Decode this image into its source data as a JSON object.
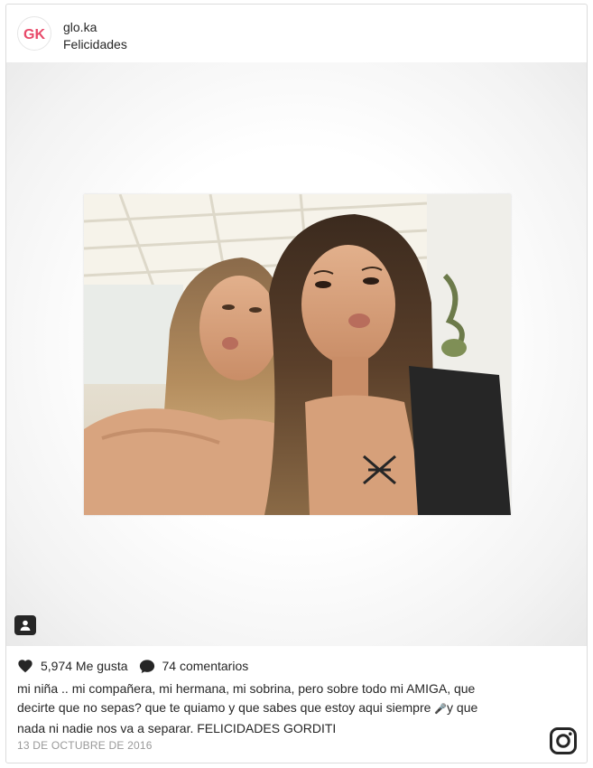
{
  "post": {
    "username": "glo.ka",
    "location": "Felicidades",
    "avatar_initials": "GK",
    "likes": "5,974 Me gusta",
    "comments": "74 comentarios",
    "caption_line1": "mi niña .. mi compañera, mi hermana, mi sobrina, pero sobre todo mi AMIGA, que",
    "caption_line2": "decirte que no sepas? que te quiamo y que sabes que estoy aqui siempre ",
    "caption_emoji": "🎤",
    "caption_line2_end": "y que",
    "caption_line3": "nada ni nadie nos va a separar. FELICIDADES GORDITI",
    "date": "13 DE OCTUBRE DE 2016"
  },
  "icons": {
    "like": "heart-icon",
    "comment": "comment-bubble-icon",
    "user_tag": "user-tag-icon",
    "brand": "instagram-logo-icon"
  },
  "colors": {
    "text": "#262626",
    "muted": "#999999",
    "avatar_pink": "#e84a6a"
  }
}
